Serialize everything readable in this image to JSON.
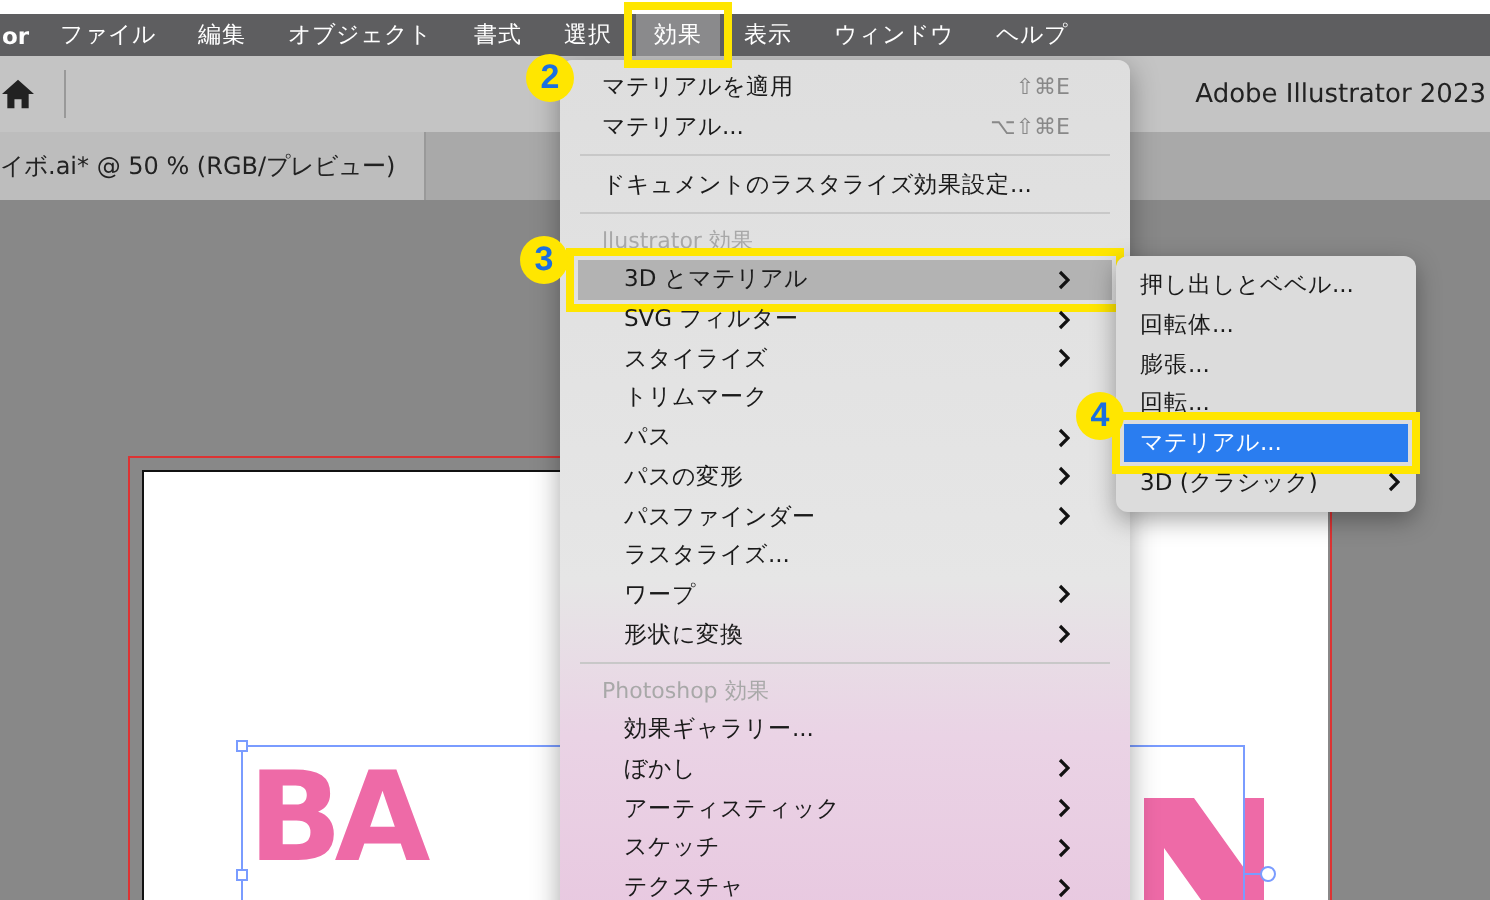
{
  "menubar": {
    "app_name": "or",
    "items": [
      {
        "label": "ファイル",
        "selected": false
      },
      {
        "label": "編集",
        "selected": false
      },
      {
        "label": "オブジェクト",
        "selected": false
      },
      {
        "label": "書式",
        "selected": false
      },
      {
        "label": "選択",
        "selected": false
      },
      {
        "label": "効果",
        "selected": true,
        "annotation": "2"
      },
      {
        "label": "表示",
        "selected": false
      },
      {
        "label": "ウィンドウ",
        "selected": false
      },
      {
        "label": "ヘルプ",
        "selected": false
      }
    ]
  },
  "toolbar": {
    "title": "Adobe Illustrator 2023"
  },
  "document_tab": {
    "label": "イボ.ai* @ 50 % (RGB/プレビュー)"
  },
  "artwork": {
    "text": "BA"
  },
  "menu": {
    "entries": [
      {
        "kind": "item",
        "label": "マテリアルを適用",
        "shortcut": "⇧⌘E",
        "submenu": false,
        "selected": false
      },
      {
        "kind": "item",
        "label": "マテリアル...",
        "shortcut": "⌥⇧⌘E",
        "submenu": false,
        "selected": false
      },
      {
        "kind": "separator"
      },
      {
        "kind": "item",
        "label": "ドキュメントのラスタライズ効果設定...",
        "submenu": false,
        "selected": false
      },
      {
        "kind": "separator"
      },
      {
        "kind": "group",
        "header": "llustrator 効果",
        "children": [
          {
            "kind": "item",
            "label": "3D とマテリアル",
            "submenu": true,
            "selected": true,
            "annotation": "3"
          },
          {
            "kind": "item",
            "label": "SVG フィルター",
            "submenu": true,
            "selected": false
          },
          {
            "kind": "item",
            "label": "スタイライズ",
            "submenu": true,
            "selected": false
          },
          {
            "kind": "item",
            "label": "トリムマーク",
            "submenu": false,
            "selected": false
          },
          {
            "kind": "item",
            "label": "パス",
            "submenu": true,
            "selected": false
          },
          {
            "kind": "item",
            "label": "パスの変形",
            "submenu": true,
            "selected": false
          },
          {
            "kind": "item",
            "label": "パスファインダー",
            "submenu": true,
            "selected": false
          },
          {
            "kind": "item",
            "label": "ラスタライズ...",
            "submenu": false,
            "selected": false
          },
          {
            "kind": "item",
            "label": "ワープ",
            "submenu": true,
            "selected": false
          },
          {
            "kind": "item",
            "label": "形状に変換",
            "submenu": true,
            "selected": false
          }
        ]
      },
      {
        "kind": "separator"
      },
      {
        "kind": "group",
        "header": "Photoshop 効果",
        "children": [
          {
            "kind": "item",
            "label": "効果ギャラリー...",
            "submenu": false,
            "selected": false
          },
          {
            "kind": "item",
            "label": "ぼかし",
            "submenu": true,
            "selected": false
          },
          {
            "kind": "item",
            "label": "アーティスティック",
            "submenu": true,
            "selected": false
          },
          {
            "kind": "item",
            "label": "スケッチ",
            "submenu": true,
            "selected": false
          },
          {
            "kind": "item",
            "label": "テクスチャ",
            "submenu": true,
            "selected": false
          }
        ]
      }
    ]
  },
  "submenu": {
    "entries": [
      {
        "kind": "item",
        "label": "押し出しとベベル...",
        "submenu": false,
        "selected": false
      },
      {
        "kind": "item",
        "label": "回転体...",
        "submenu": false,
        "selected": false
      },
      {
        "kind": "item",
        "label": "膨張...",
        "submenu": false,
        "selected": false
      },
      {
        "kind": "item",
        "label": "回転...",
        "submenu": false,
        "selected": false
      },
      {
        "kind": "item",
        "label": "マテリアル...",
        "submenu": false,
        "selected": true,
        "annotation": "4"
      },
      {
        "kind": "item",
        "label": "3D (クラシック)",
        "submenu": true,
        "selected": false
      }
    ]
  }
}
